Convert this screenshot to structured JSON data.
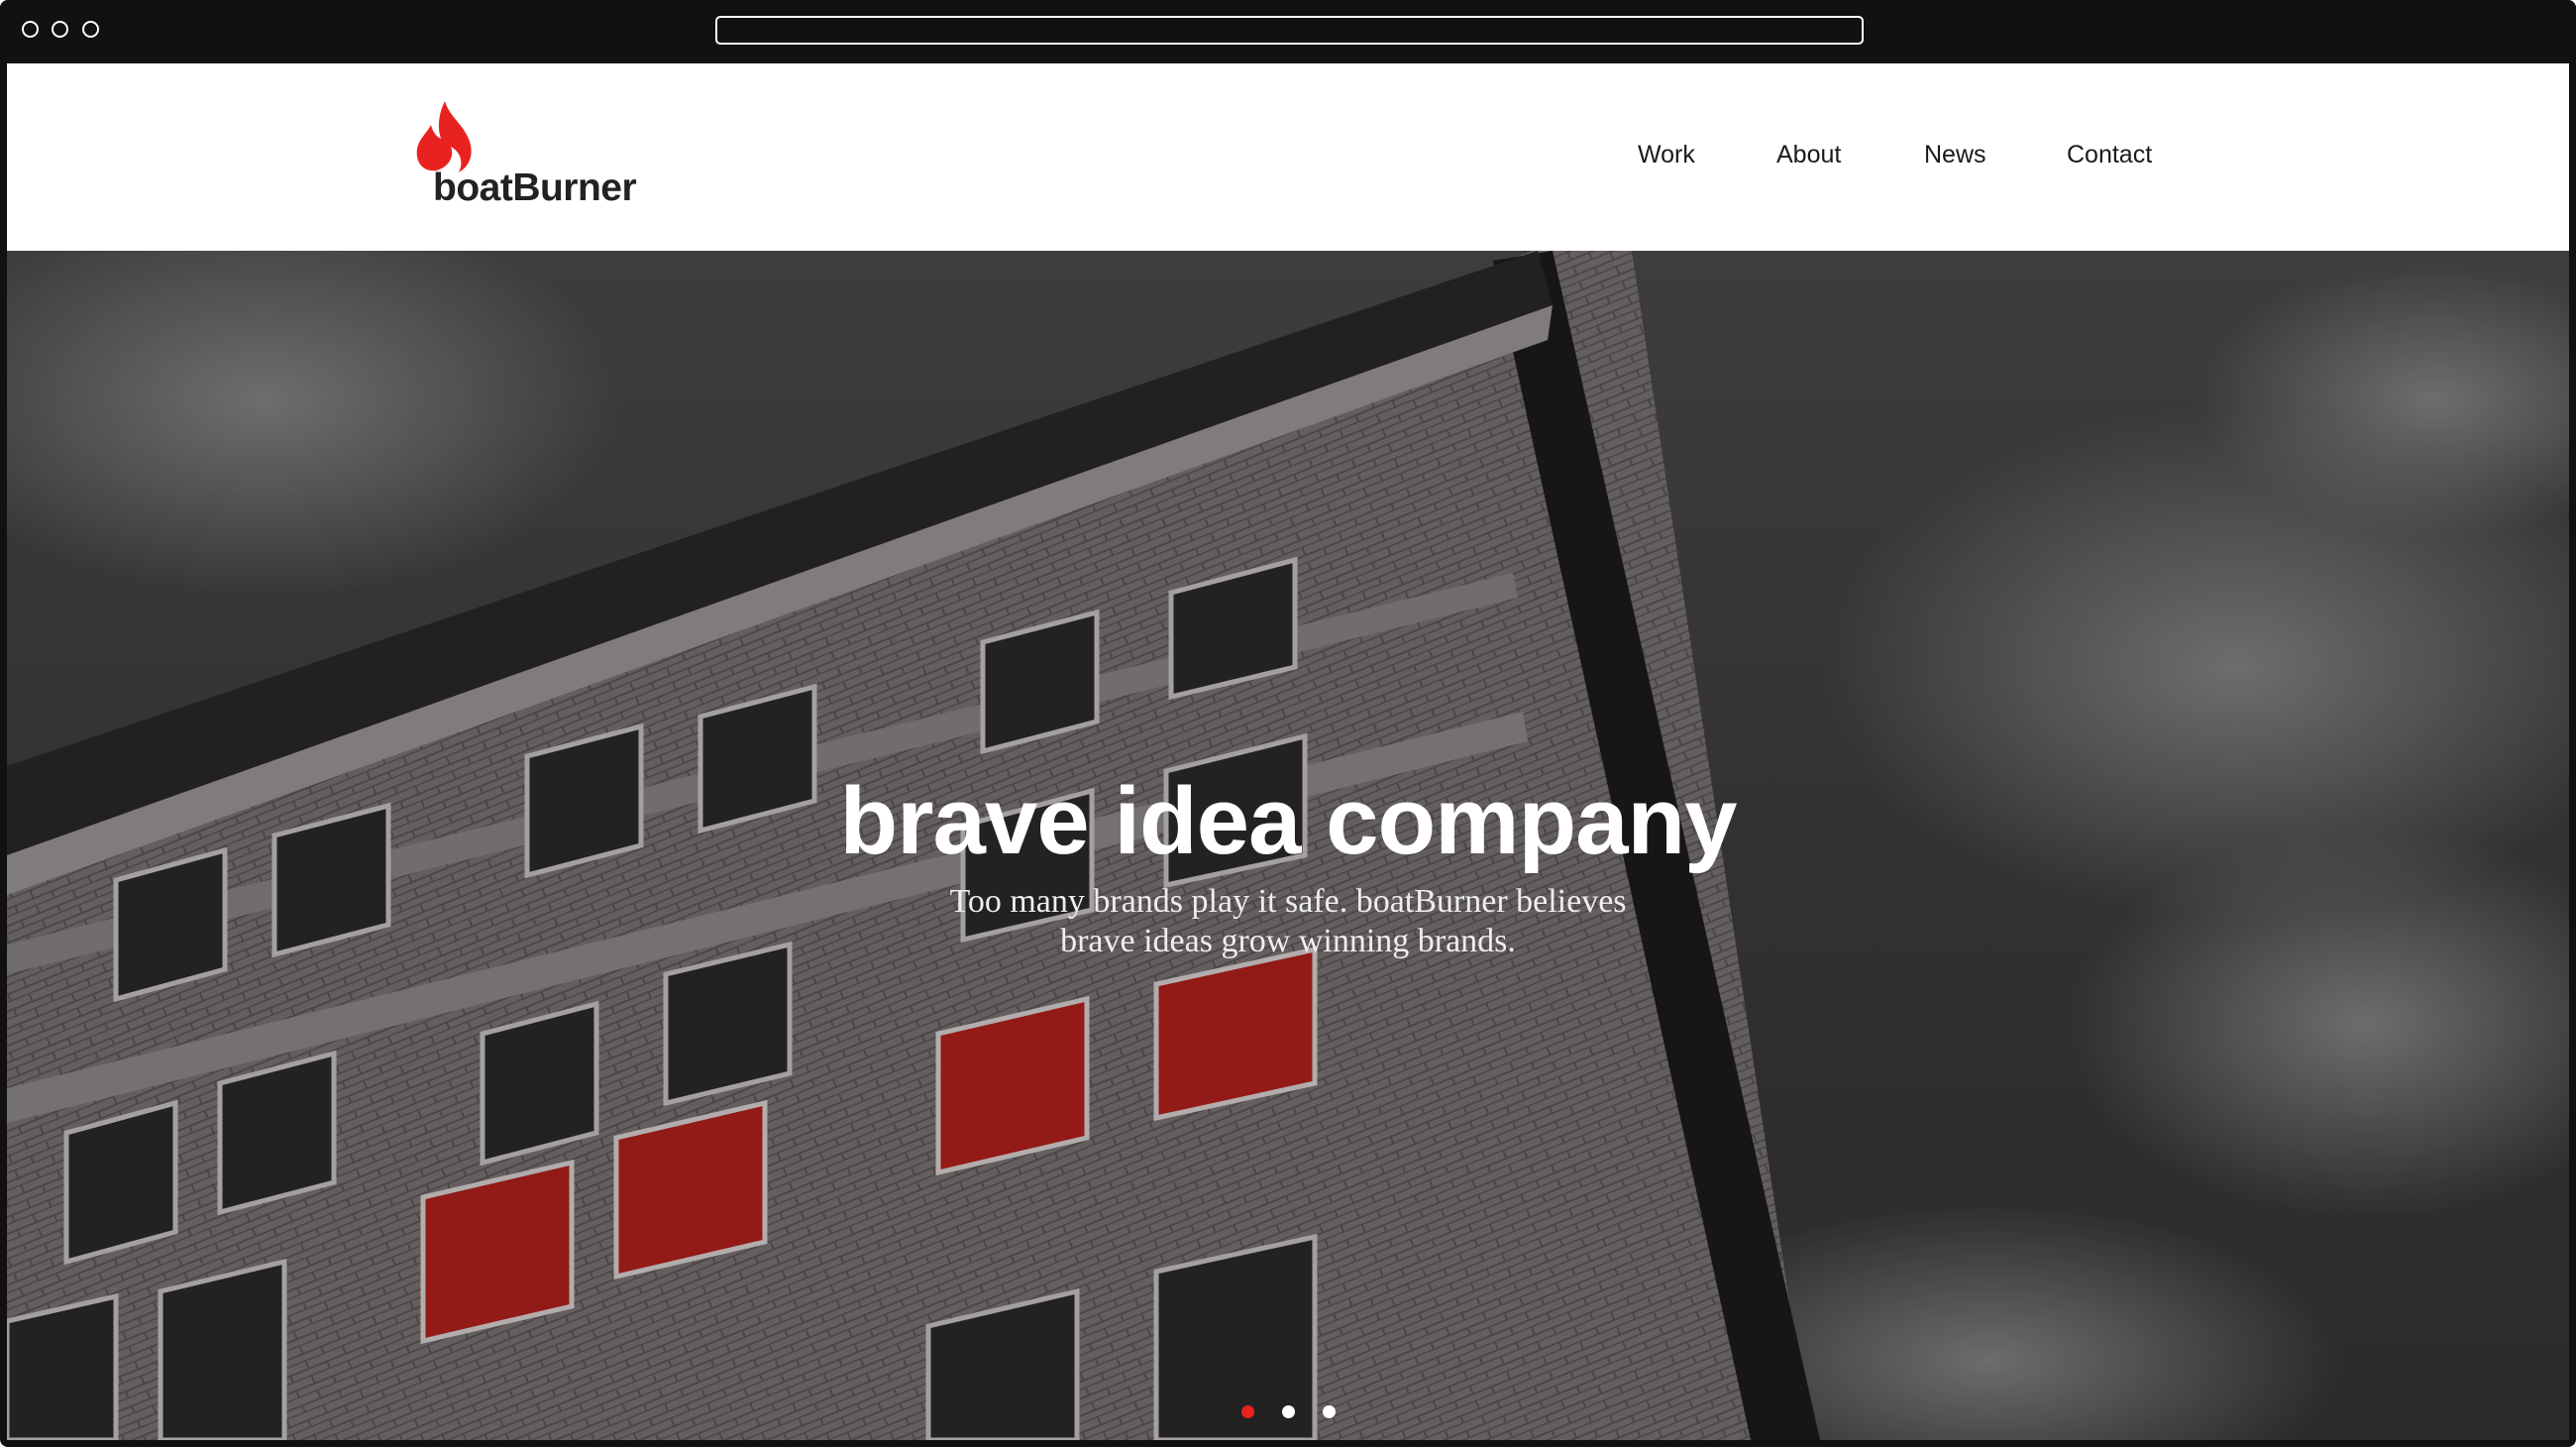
{
  "brand": {
    "name": "boatBurner",
    "icon": "flame-icon",
    "accent": "#e8231f"
  },
  "nav": {
    "items": [
      "Work",
      "About",
      "News",
      "Contact"
    ]
  },
  "hero": {
    "title": "brave idea company",
    "subtitle_line1": "Too many brands play it safe. boatBurner believes",
    "subtitle_line2": "brave ideas grow winning brands."
  },
  "carousel": {
    "slides": 3,
    "active": 1,
    "active_color": "#e8231f",
    "inactive_color": "#ffffff"
  },
  "browser": {
    "controls": [
      "window-control-icon",
      "window-control-icon",
      "window-control-icon"
    ]
  }
}
